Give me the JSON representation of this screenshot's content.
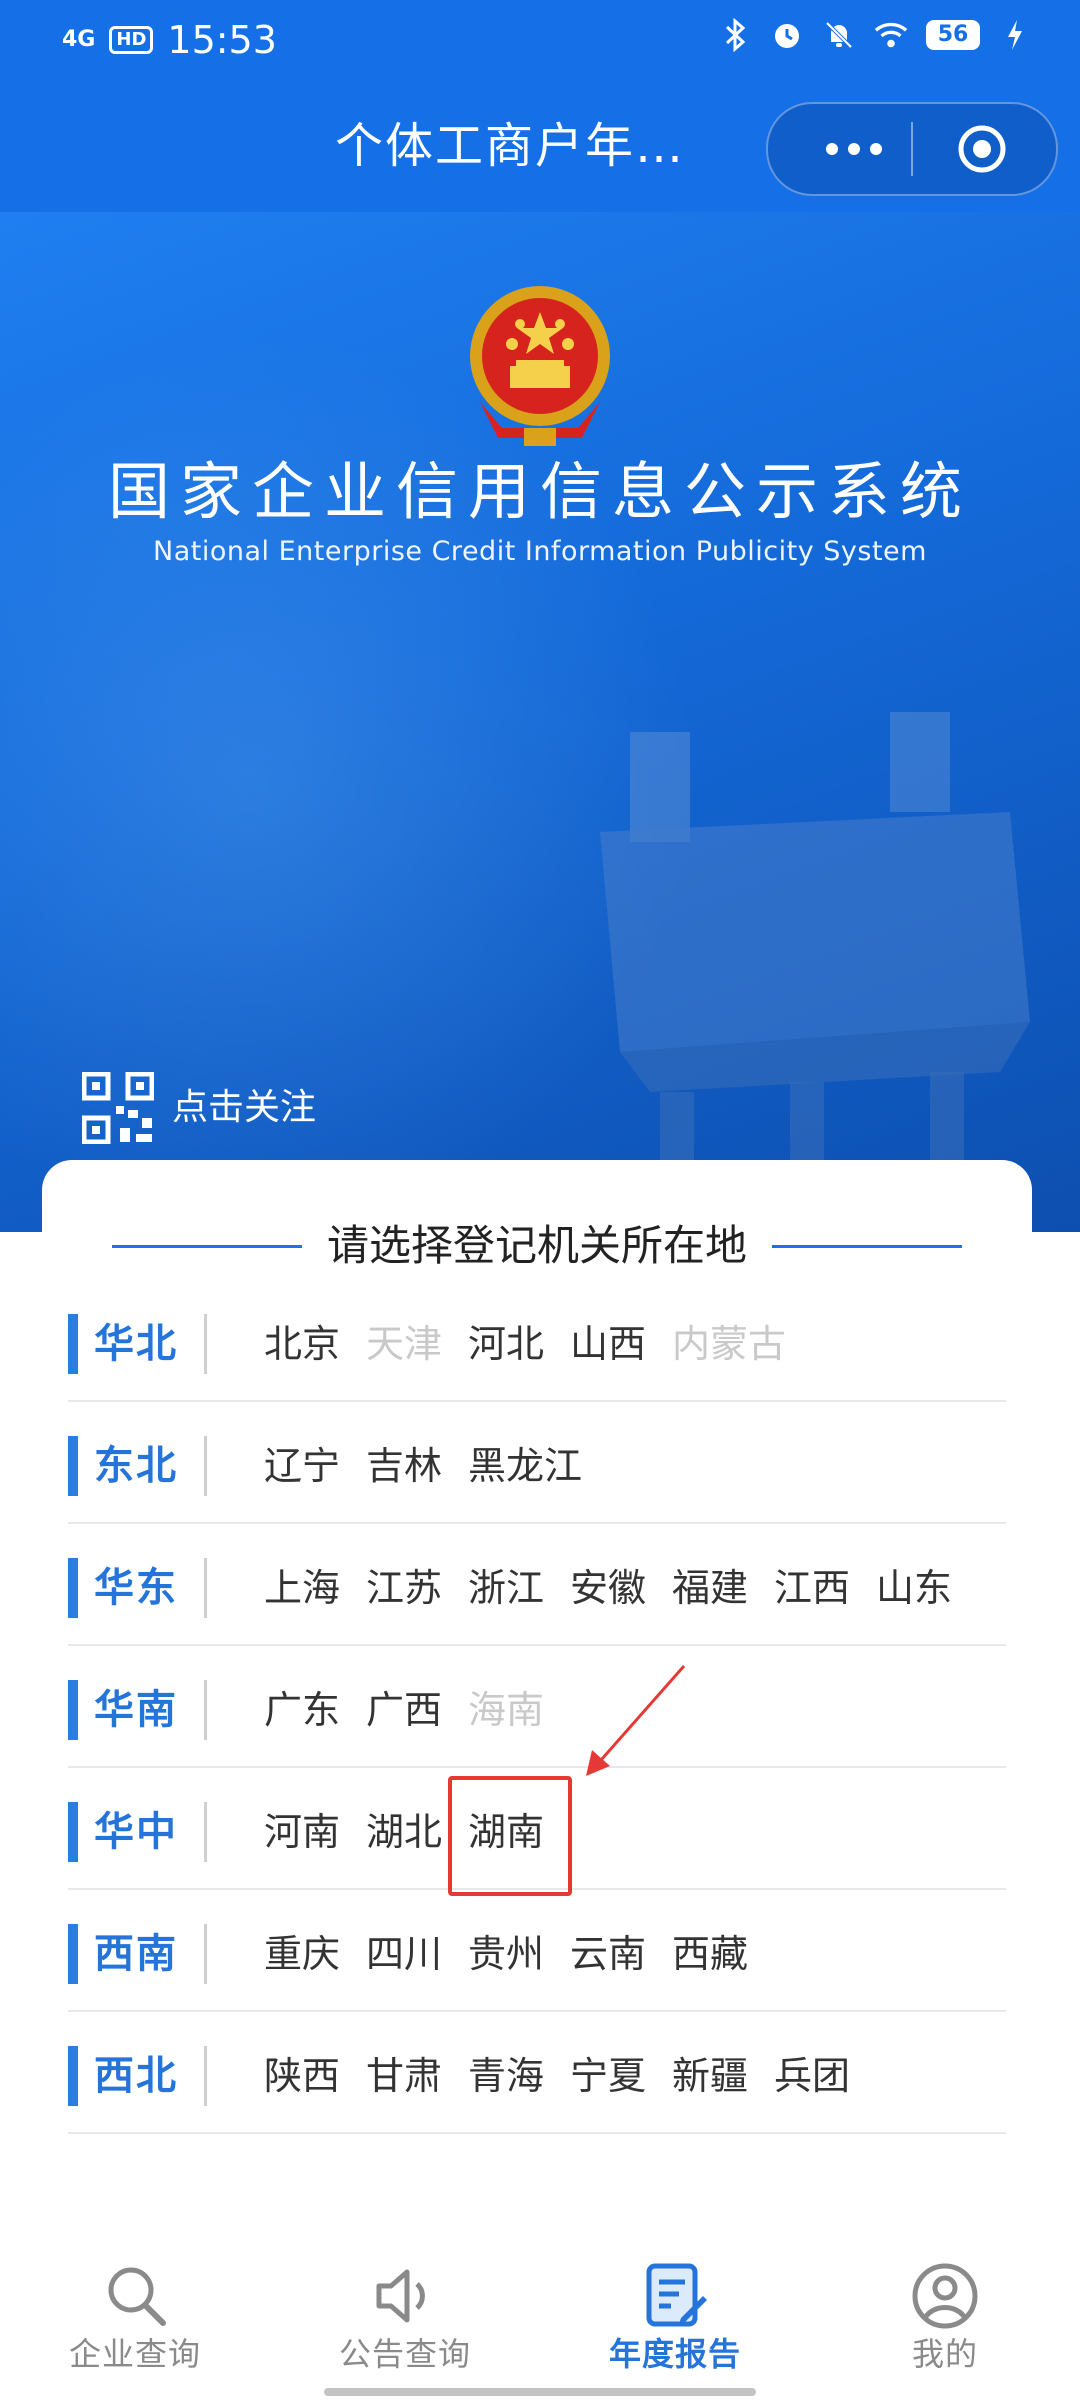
{
  "status_bar": {
    "network": "4G",
    "hd": "HD",
    "time": "15:53",
    "battery": "56"
  },
  "header": {
    "title": "个体工商户年…"
  },
  "hero": {
    "title": "国家企业信用信息公示系统",
    "subtitle": "National Enterprise Credit Information Publicity System",
    "follow_label": "点击关注"
  },
  "card": {
    "heading": "请选择登记机关所在地",
    "regions": [
      {
        "name": "华北",
        "items": [
          {
            "label": "北京",
            "state": "normal"
          },
          {
            "label": "天津",
            "state": "disabled"
          },
          {
            "label": "河北",
            "state": "normal"
          },
          {
            "label": "山西",
            "state": "normal"
          },
          {
            "label": "内蒙古",
            "state": "disabled"
          }
        ]
      },
      {
        "name": "东北",
        "items": [
          {
            "label": "辽宁",
            "state": "normal"
          },
          {
            "label": "吉林",
            "state": "normal"
          },
          {
            "label": "黑龙江",
            "state": "normal"
          }
        ]
      },
      {
        "name": "华东",
        "items": [
          {
            "label": "上海",
            "state": "normal"
          },
          {
            "label": "江苏",
            "state": "normal"
          },
          {
            "label": "浙江",
            "state": "normal"
          },
          {
            "label": "安徽",
            "state": "normal"
          },
          {
            "label": "福建",
            "state": "normal"
          },
          {
            "label": "江西",
            "state": "normal"
          },
          {
            "label": "山东",
            "state": "normal"
          }
        ]
      },
      {
        "name": "华南",
        "items": [
          {
            "label": "广东",
            "state": "normal"
          },
          {
            "label": "广西",
            "state": "normal"
          },
          {
            "label": "海南",
            "state": "disabled"
          }
        ]
      },
      {
        "name": "华中",
        "items": [
          {
            "label": "河南",
            "state": "normal"
          },
          {
            "label": "湖北",
            "state": "normal"
          },
          {
            "label": "湖南",
            "state": "highlight"
          }
        ]
      },
      {
        "name": "西南",
        "items": [
          {
            "label": "重庆",
            "state": "normal"
          },
          {
            "label": "四川",
            "state": "normal"
          },
          {
            "label": "贵州",
            "state": "normal"
          },
          {
            "label": "云南",
            "state": "normal"
          },
          {
            "label": "西藏",
            "state": "normal"
          }
        ]
      },
      {
        "name": "西北",
        "items": [
          {
            "label": "陕西",
            "state": "normal"
          },
          {
            "label": "甘肃",
            "state": "normal"
          },
          {
            "label": "青海",
            "state": "normal"
          },
          {
            "label": "宁夏",
            "state": "normal"
          },
          {
            "label": "新疆",
            "state": "normal"
          },
          {
            "label": "兵团",
            "state": "normal"
          }
        ]
      }
    ]
  },
  "nav": {
    "tabs": [
      {
        "label": "企业查询",
        "icon": "search-icon"
      },
      {
        "label": "公告查询",
        "icon": "speaker-icon"
      },
      {
        "label": "年度报告",
        "icon": "report-edit-icon"
      },
      {
        "label": "我的",
        "icon": "user-icon"
      }
    ],
    "active_index": 2
  },
  "colors": {
    "brand_blue": "#1570e8",
    "region_blue": "#2574d9",
    "highlight_red": "#e53935",
    "disabled_gray": "#c9c9c9"
  }
}
